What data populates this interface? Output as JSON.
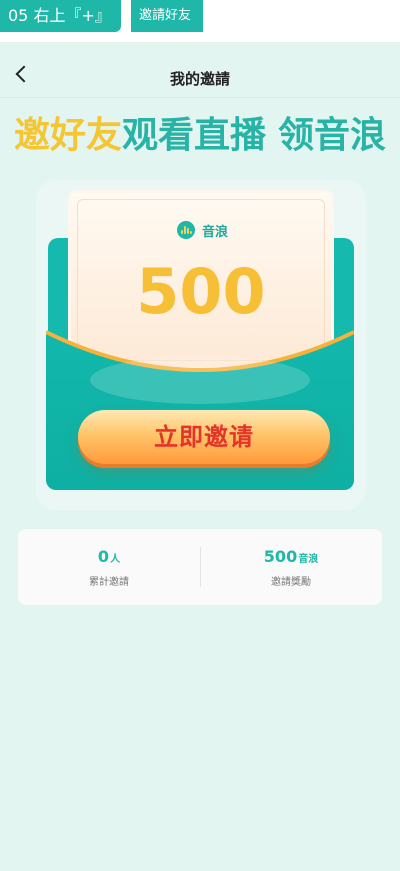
{
  "annotations": {
    "step_label": "05 右上『+』",
    "feature_label": "邀請好友"
  },
  "navbar": {
    "title": "我的邀請",
    "back_icon": "chevron-left-icon"
  },
  "banner": {
    "part1": "邀好友",
    "part2": "观看直播",
    "part3": "领音浪"
  },
  "reward_card": {
    "currency_icon": "sound-wave-coin-icon",
    "currency_label": "音浪",
    "amount": "500"
  },
  "invite_button": {
    "label": "立即邀请"
  },
  "stats": {
    "invited_count": "0",
    "invited_unit": "人",
    "invited_label": "累計邀請",
    "reward_amount": "500",
    "reward_unit": "音浪",
    "reward_label": "邀請獎勵"
  },
  "colors": {
    "accent": "#1fb8a8",
    "page_bg": "#e3f5f1",
    "gold": "#f7bf35",
    "button_text": "#e5332a"
  }
}
